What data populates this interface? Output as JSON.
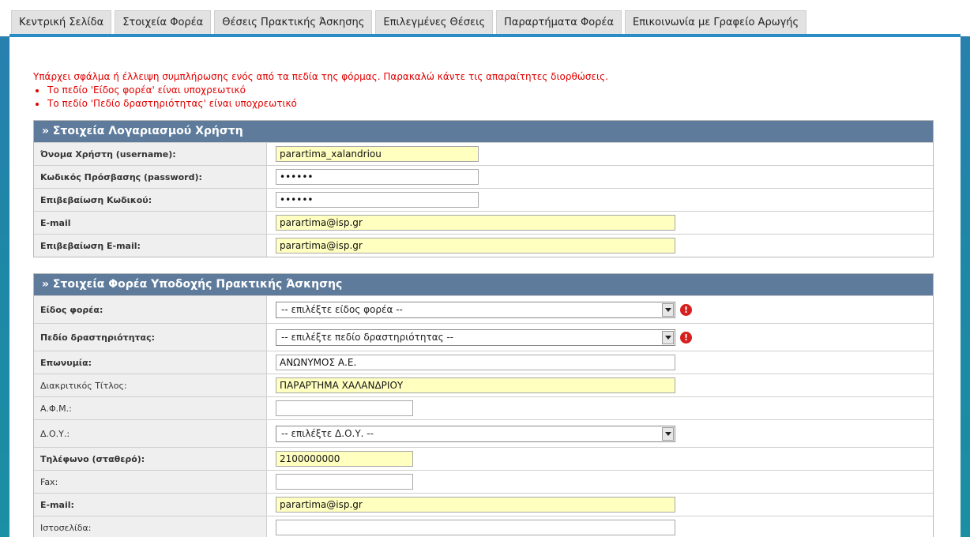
{
  "tabs": [
    "Κεντρική Σελίδα",
    "Στοιχεία Φορέα",
    "Θέσεις Πρακτικής Άσκησης",
    "Επιλεγμένες Θέσεις",
    "Παραρτήματα Φορέα",
    "Επικοινωνία με Γραφείο Αρωγής"
  ],
  "errors": {
    "message": "Υπάρχει σφάλμα ή έλλειψη συμπλήρωσης ενός από τα πεδία της φόρμας. Παρακαλώ κάντε τις απαραίτητες διορθώσεις.",
    "items": [
      "Το πεδίο 'Είδος φορέα' είναι υποχρεωτικό",
      "Το πεδίο 'Πεδίο δραστηριότητας' είναι υποχρεωτικό"
    ]
  },
  "account": {
    "title": "» Στοιχεία Λογαριασμού Χρήστη",
    "username_label": "Όνομα Χρήστη (username):",
    "username_value": "parartima_xalandriou",
    "password_label": "Κωδικός Πρόσβασης (password):",
    "password_value": "••••••",
    "password_confirm_label": "Επιβεβαίωση Κωδικού:",
    "password_confirm_value": "••••••",
    "email_label": "E-mail",
    "email_value": "parartima@isp.gr",
    "email_confirm_label": "Επιβεβαίωση E-mail:",
    "email_confirm_value": "parartima@isp.gr"
  },
  "provider": {
    "title": "» Στοιχεία Φορέα Υποδοχής Πρακτικής Άσκησης",
    "type_label": "Είδος φορέα:",
    "type_value": "-- επιλέξτε είδος φορέα --",
    "field_label": "Πεδίο δραστηριότητας:",
    "field_value": "-- επιλέξτε πεδίο δραστηριότητας --",
    "name_label": "Επωνυμία:",
    "name_value": "ΑΝΩΝΥΜΟΣ Α.Ε.",
    "distinct_label": "Διακριτικός Τίτλος:",
    "distinct_value": "ΠΑΡΑΡΤΗΜΑ ΧΑΛΑΝΔΡΙΟΥ",
    "afm_label": "Α.Φ.Μ.:",
    "afm_value": "",
    "doy_label": "Δ.Ο.Υ.:",
    "doy_value": "-- επιλέξτε Δ.Ο.Υ. --",
    "phone_label": "Τηλέφωνο (σταθερό):",
    "phone_value": "2100000000",
    "fax_label": "Fax:",
    "fax_value": "",
    "email_label": "E-mail:",
    "email_value": "parartima@isp.gr",
    "website_label": "Ιστοσελίδα:",
    "website_value": ""
  },
  "icons": {
    "error": "!"
  },
  "colors": {
    "panel_header": "#5e7b9c",
    "error_text": "#e00000",
    "tab_line": "#2b8bc6",
    "required_fill": "#ffffc0"
  }
}
